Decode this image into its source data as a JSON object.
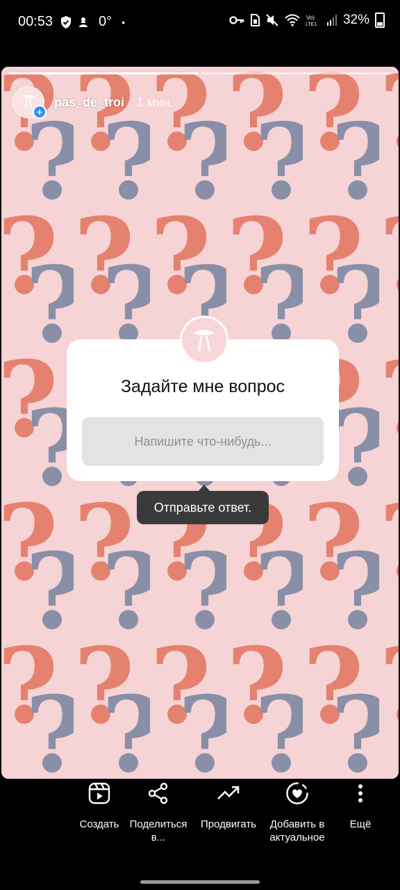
{
  "status_bar": {
    "time": "00:53",
    "temperature": "0°",
    "dot": "•",
    "battery": "32%",
    "icons": [
      "shield-check-icon",
      "weather-icon",
      "key-icon",
      "sim-icon",
      "mute-icon",
      "wifi-icon",
      "volte-icon",
      "signal-icon",
      "battery-icon"
    ]
  },
  "story": {
    "username": "pas_de_troi",
    "time_ago": "1 мин.",
    "progress_segments": 2,
    "progress_current": 1,
    "background": "question-marks-pattern",
    "colors": {
      "pink_bg": "#f6d3d5",
      "coral": "#e5826f",
      "slate": "#8a8fa8"
    }
  },
  "question_sticker": {
    "title": "Задайте мне вопрос",
    "placeholder": "Напишите что-нибудь..."
  },
  "tooltip": {
    "text": "Отправьте ответ."
  },
  "bottom_actions": [
    {
      "icon": "reels-create-icon",
      "label": "Создать"
    },
    {
      "icon": "share-icon",
      "label": "Поделиться в..."
    },
    {
      "icon": "trending-up-icon",
      "label": "Продвигать"
    },
    {
      "icon": "highlight-heart-icon",
      "label": "Добавить в актуальное"
    },
    {
      "icon": "more-vertical-icon",
      "label": "Ещё"
    }
  ]
}
